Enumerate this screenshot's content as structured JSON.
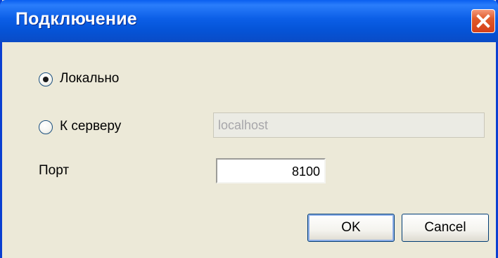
{
  "window": {
    "title": "Подключение",
    "close_icon": "close-icon"
  },
  "connection": {
    "local_label": "Локально",
    "local_selected": true,
    "server_label": "К серверу",
    "server_selected": false,
    "server_value": "localhost"
  },
  "port": {
    "label": "Порт",
    "value": "8100"
  },
  "buttons": {
    "ok_label": "OK",
    "cancel_label": "Cancel"
  },
  "colors": {
    "titlebar": "#0554d8",
    "close_button": "#d5401a",
    "dialog_background": "#ece9d8"
  }
}
